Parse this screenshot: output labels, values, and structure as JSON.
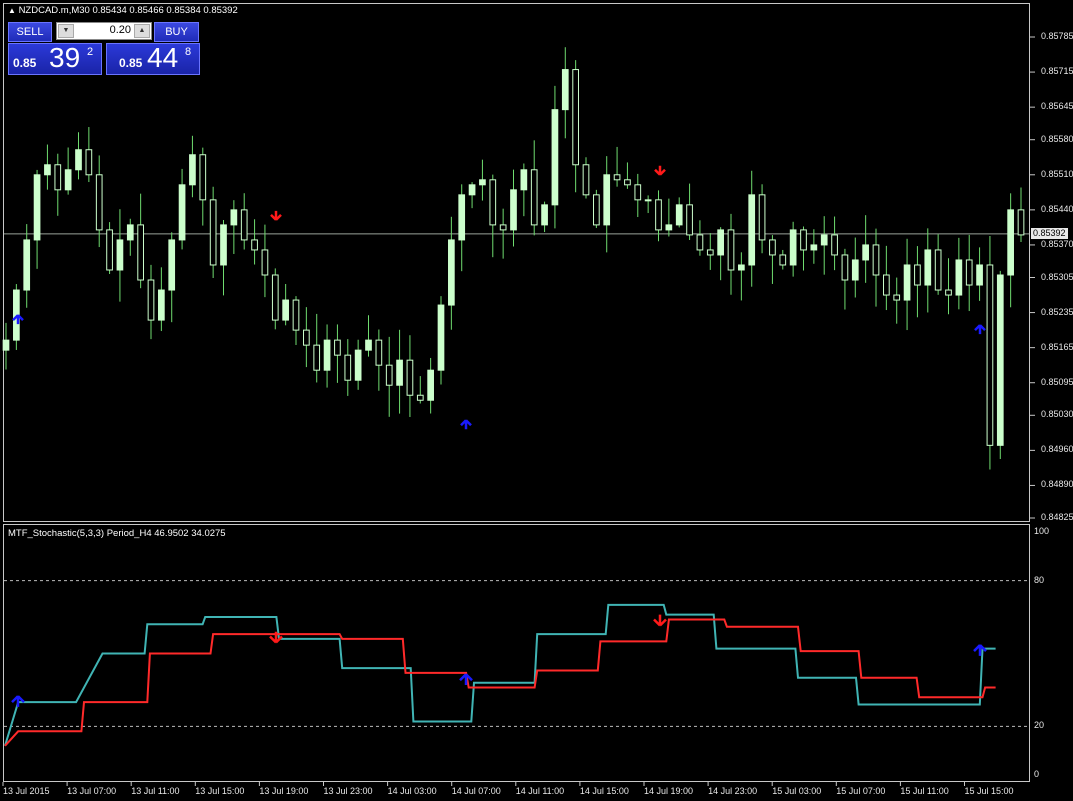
{
  "chart_header": {
    "symbol_line": "NZDCAD.m,M30  0.85434 0.85466 0.85384 0.85392"
  },
  "trade_panel": {
    "sell_label": "SELL",
    "buy_label": "BUY",
    "lot_value": "0.20",
    "bid": {
      "prefix": "0.85",
      "big": "39",
      "sup": "2"
    },
    "ask": {
      "prefix": "0.85",
      "big": "44",
      "sup": "8"
    }
  },
  "price_axis": {
    "labels": [
      "0.85785",
      "0.85715",
      "0.85645",
      "0.85580",
      "0.85510",
      "0.85440",
      "0.85370",
      "0.85305",
      "0.85235",
      "0.85165",
      "0.85095",
      "0.85030",
      "0.84960",
      "0.84890",
      "0.84825"
    ],
    "current_price": "0.85392"
  },
  "indicator": {
    "title": "MTF_Stochastic(5,3,3) Period_H4 46.9502 34.0275",
    "levels": [
      "100",
      "80",
      "20",
      "0"
    ]
  },
  "time_axis": {
    "labels": [
      "13 Jul 2015",
      "13 Jul 07:00",
      "13 Jul 11:00",
      "13 Jul 15:00",
      "13 Jul 19:00",
      "13 Jul 23:00",
      "14 Jul 03:00",
      "14 Jul 07:00",
      "14 Jul 11:00",
      "14 Jul 15:00",
      "14 Jul 19:00",
      "14 Jul 23:00",
      "15 Jul 03:00",
      "15 Jul 07:00",
      "15 Jul 11:00",
      "15 Jul 15:00"
    ]
  },
  "colors": {
    "bull_candle": "#ccffcc",
    "wick": "#6fdc6f",
    "stoch_main": "#40b4b4",
    "stoch_signal": "#ff2a2a",
    "arrow_up": "#1a1aff",
    "arrow_down": "#ff1a1a"
  },
  "chart_data": [
    {
      "type": "candlestick",
      "title": "NZDCAD.m,M30",
      "ylim": [
        0.84825,
        0.85785
      ],
      "x_labels": [
        "13 Jul 2015",
        "13 Jul 07:00",
        "13 Jul 11:00",
        "13 Jul 15:00",
        "13 Jul 19:00",
        "13 Jul 23:00",
        "14 Jul 03:00",
        "14 Jul 07:00",
        "14 Jul 11:00",
        "14 Jul 15:00",
        "14 Jul 19:00",
        "14 Jul 23:00",
        "15 Jul 03:00",
        "15 Jul 07:00",
        "15 Jul 11:00",
        "15 Jul 15:00"
      ],
      "close_path": [
        0.8518,
        0.8528,
        0.8538,
        0.8551,
        0.8553,
        0.8548,
        0.8552,
        0.8556,
        0.8551,
        0.854,
        0.8532,
        0.8538,
        0.8541,
        0.853,
        0.8522,
        0.8528,
        0.8538,
        0.8549,
        0.8555,
        0.8546,
        0.8533,
        0.8541,
        0.8544,
        0.8538,
        0.8536,
        0.8531,
        0.8522,
        0.8526,
        0.852,
        0.8517,
        0.8512,
        0.8518,
        0.8515,
        0.851,
        0.8516,
        0.8518,
        0.8513,
        0.8509,
        0.8514,
        0.8507,
        0.8506,
        0.8512,
        0.8525,
        0.8538,
        0.8547,
        0.8549,
        0.855,
        0.8541,
        0.854,
        0.8548,
        0.8552,
        0.8541,
        0.8545,
        0.8564,
        0.8572,
        0.8553,
        0.8547,
        0.8541,
        0.8551,
        0.855,
        0.8549,
        0.8546,
        0.8546,
        0.854,
        0.8541,
        0.8545,
        0.8539,
        0.8536,
        0.8535,
        0.854,
        0.8532,
        0.8533,
        0.8547,
        0.8538,
        0.8535,
        0.8533,
        0.854,
        0.8536,
        0.8537,
        0.8539,
        0.8535,
        0.853,
        0.8534,
        0.8537,
        0.8531,
        0.8527,
        0.8526,
        0.8533,
        0.8529,
        0.8536,
        0.8528,
        0.8527,
        0.8534,
        0.8529,
        0.8533,
        0.8497,
        0.8531,
        0.8544,
        0.8539
      ],
      "signals": [
        {
          "type": "buy",
          "at": "13 Jul 2015",
          "price": 0.8523
        },
        {
          "type": "sell",
          "at": "13 Jul 19:00",
          "price": 0.8542
        },
        {
          "type": "buy",
          "at": "14 Jul 07:00",
          "price": 0.8502
        },
        {
          "type": "sell",
          "at": "14 Jul 19:00",
          "price": 0.8551
        },
        {
          "type": "buy",
          "at": "15 Jul 15:00",
          "price": 0.8521
        }
      ],
      "current_price": 0.85392
    },
    {
      "type": "line",
      "title": "MTF_Stochastic(5,3,3) Period_H4 46.9502 34.0275",
      "ylim": [
        0,
        100
      ],
      "levels": [
        80,
        20
      ],
      "series": [
        {
          "name": "main",
          "steps": [
            [
              0,
              12
            ],
            [
              5,
              30
            ],
            [
              26,
              30
            ],
            [
              27,
              30
            ],
            [
              37,
              50
            ],
            [
              53,
              50
            ],
            [
              54,
              62
            ],
            [
              75,
              62
            ],
            [
              76,
              65
            ],
            [
              103,
              65
            ],
            [
              104,
              56
            ],
            [
              127,
              56
            ],
            [
              128,
              44
            ],
            [
              154,
              44
            ],
            [
              155,
              22
            ],
            [
              177,
              22
            ],
            [
              178,
              38
            ],
            [
              201,
              38
            ],
            [
              202,
              58
            ],
            [
              228,
              58
            ],
            [
              229,
              70
            ],
            [
              250,
              70
            ],
            [
              251,
              66
            ],
            [
              269,
              66
            ],
            [
              270,
              52
            ],
            [
              300,
              52
            ],
            [
              301,
              40
            ],
            [
              323,
              40
            ],
            [
              324,
              29
            ],
            [
              370,
              29
            ],
            [
              371,
              52
            ],
            [
              376,
              52
            ]
          ]
        },
        {
          "name": "signal",
          "steps": [
            [
              0,
              12
            ],
            [
              5,
              18
            ],
            [
              29,
              18
            ],
            [
              30,
              30
            ],
            [
              54,
              30
            ],
            [
              55,
              50
            ],
            [
              78,
              50
            ],
            [
              79,
              58
            ],
            [
              127,
              58
            ],
            [
              128,
              56
            ],
            [
              151,
              56
            ],
            [
              152,
              42
            ],
            [
              175,
              42
            ],
            [
              176,
              36
            ],
            [
              201,
              36
            ],
            [
              202,
              43
            ],
            [
              225,
              43
            ],
            [
              226,
              55
            ],
            [
              251,
              55
            ],
            [
              252,
              64
            ],
            [
              273,
              64
            ],
            [
              274,
              61
            ],
            [
              301,
              61
            ],
            [
              302,
              51
            ],
            [
              324,
              51
            ],
            [
              325,
              40
            ],
            [
              346,
              40
            ],
            [
              347,
              32
            ],
            [
              371,
              32
            ],
            [
              372,
              36
            ],
            [
              376,
              36
            ]
          ]
        }
      ],
      "signals": [
        {
          "type": "buy",
          "at": "13 Jul 2015",
          "value": 30
        },
        {
          "type": "sell",
          "at": "13 Jul 19:00",
          "value": 57
        },
        {
          "type": "buy",
          "at": "14 Jul 07:00",
          "value": 39
        },
        {
          "type": "sell",
          "at": "14 Jul 19:00",
          "value": 64
        },
        {
          "type": "buy",
          "at": "15 Jul 15:00",
          "value": 51
        }
      ]
    }
  ]
}
